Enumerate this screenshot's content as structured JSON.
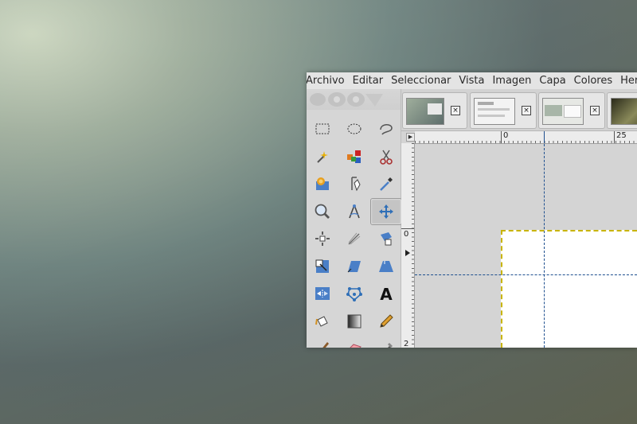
{
  "menubar": {
    "items": [
      "Archivo",
      "Editar",
      "Seleccionar",
      "Vista",
      "Imagen",
      "Capa",
      "Colores",
      "Herramientas"
    ]
  },
  "image_tabs": [
    {
      "thumb_icon": "image-thumbnail-1",
      "close_label": "×"
    },
    {
      "thumb_icon": "image-thumbnail-2",
      "close_label": "×"
    },
    {
      "thumb_icon": "image-thumbnail-3",
      "close_label": "×"
    },
    {
      "thumb_icon": "image-thumbnail-4"
    }
  ],
  "canvas": {
    "menu_arrow": "▶",
    "ruler_top_labels": [
      "0",
      "25"
    ],
    "ruler_left_labels": [
      "0",
      "2"
    ]
  },
  "toolbox": {
    "tools": [
      "rect-select-icon",
      "ellipse-select-icon",
      "free-select-icon",
      "fuzzy-select-icon",
      "select-by-color-icon",
      "scissors-select-icon",
      "foreground-select-icon",
      "paths-icon",
      "color-picker-icon",
      "zoom-icon",
      "measure-icon",
      "move-icon",
      "alignment-icon",
      "crop-icon",
      "unified-transform-icon",
      "scale-icon",
      "shear-icon",
      "perspective-icon",
      "flip-icon",
      "cage-transform-icon",
      "text-icon",
      "bucket-fill-icon",
      "gradient-icon",
      "pencil-icon",
      "paintbrush-icon",
      "eraser-icon",
      "airbrush-icon"
    ],
    "active_tool": "move-icon"
  },
  "colors": {
    "accent": "#2f6fb7",
    "selection": "#c8b400",
    "guide": "#1e4f8f"
  }
}
